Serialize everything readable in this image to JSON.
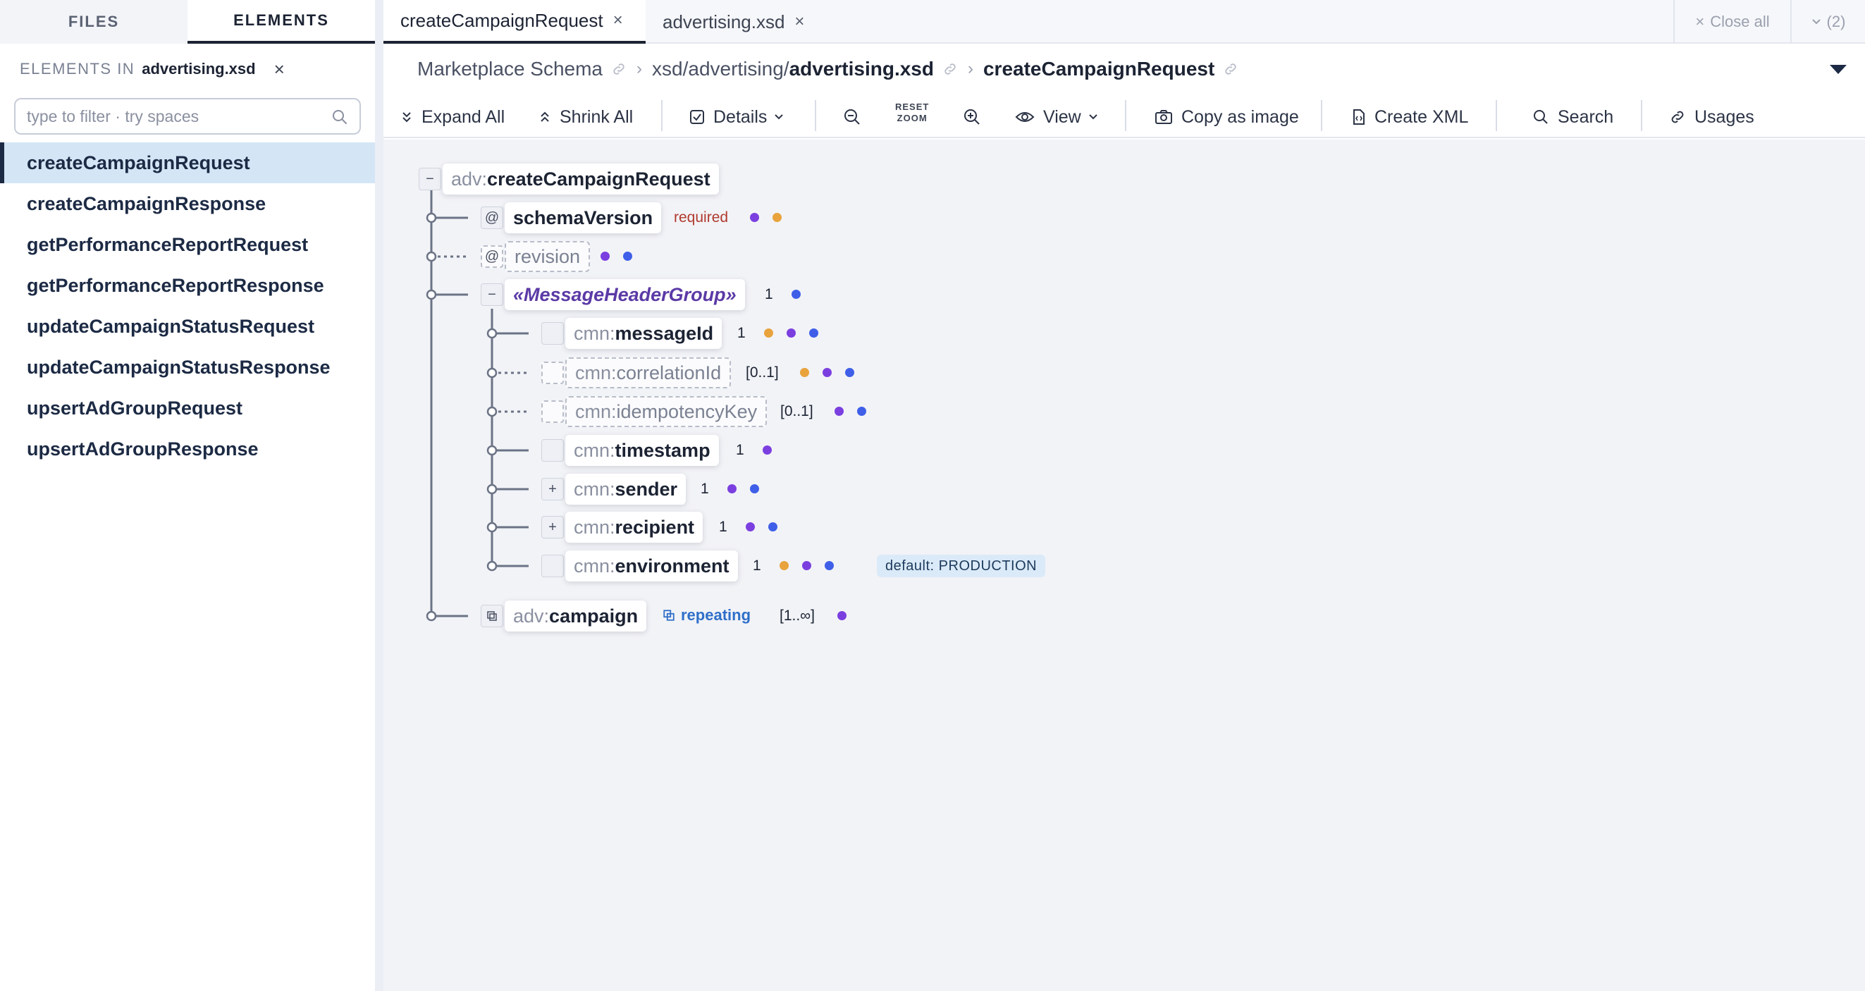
{
  "sidebar": {
    "tabs": [
      "FILES",
      "ELEMENTS"
    ],
    "header_prefix": "ELEMENTS IN",
    "header_file": "advertising.xsd",
    "close_glyph": "×",
    "filter_placeholder": "type to filter · try spaces",
    "items": [
      {
        "label": "createCampaignRequest"
      },
      {
        "label": "createCampaignResponse"
      },
      {
        "label": "getPerformanceReportRequest"
      },
      {
        "label": "getPerformanceReportResponse"
      },
      {
        "label": "updateCampaignStatusRequest"
      },
      {
        "label": "updateCampaignStatusResponse"
      },
      {
        "label": "upsertAdGroupRequest"
      },
      {
        "label": "upsertAdGroupResponse"
      }
    ],
    "active_index": 0
  },
  "tabs": {
    "items": [
      {
        "label": "createCampaignRequest",
        "close": "×"
      },
      {
        "label": "advertising.xsd",
        "close": "×"
      }
    ],
    "close_all": "Close all",
    "count": "(2)"
  },
  "breadcrumb": {
    "root": "Marketplace Schema",
    "path_prefix": "xsd/advertising/",
    "path_file": "advertising.xsd",
    "current": "createCampaignRequest"
  },
  "toolbar": {
    "expand_all": "Expand All",
    "shrink_all": "Shrink All",
    "details": "Details",
    "reset_zoom_1": "RESET",
    "reset_zoom_2": "ZOOM",
    "view": "View",
    "copy_image": "Copy as image",
    "create_xml": "Create XML",
    "search": "Search",
    "usages": "Usages"
  },
  "tree": {
    "root": {
      "prefix": "adv:",
      "name": "createCampaignRequest",
      "toggle": "−"
    },
    "schemaVersion": {
      "toggle": "@",
      "name": "schemaVersion",
      "required": "required"
    },
    "revision": {
      "toggle": "@",
      "name": "revision"
    },
    "group": {
      "toggle": "−",
      "name": "«MessageHeaderGroup»",
      "card": "1"
    },
    "messageId": {
      "prefix": "cmn:",
      "name": "messageId",
      "card": "1"
    },
    "correlationId": {
      "prefix": "cmn:",
      "name": "correlationId",
      "card": "[0..1]"
    },
    "idempotencyKey": {
      "prefix": "cmn:",
      "name": "idempotencyKey",
      "card": "[0..1]"
    },
    "timestamp": {
      "prefix": "cmn:",
      "name": "timestamp",
      "card": "1"
    },
    "sender": {
      "toggle": "+",
      "prefix": "cmn:",
      "name": "sender",
      "card": "1"
    },
    "recipient": {
      "toggle": "+",
      "prefix": "cmn:",
      "name": "recipient",
      "card": "1"
    },
    "environment": {
      "prefix": "cmn:",
      "name": "environment",
      "card": "1",
      "default": "default: PRODUCTION"
    },
    "campaign": {
      "prefix": "adv:",
      "name": "campaign",
      "repeating": "repeating",
      "card": "[1..∞]"
    }
  },
  "colors": {
    "dot_orange": "#e8a33d",
    "dot_purple": "#7b3fe0",
    "dot_blue": "#3f5fe8",
    "active_item_bg": "#d4e6f6",
    "required_text": "#b03a2e",
    "repeating_text": "#2f6fc9"
  }
}
